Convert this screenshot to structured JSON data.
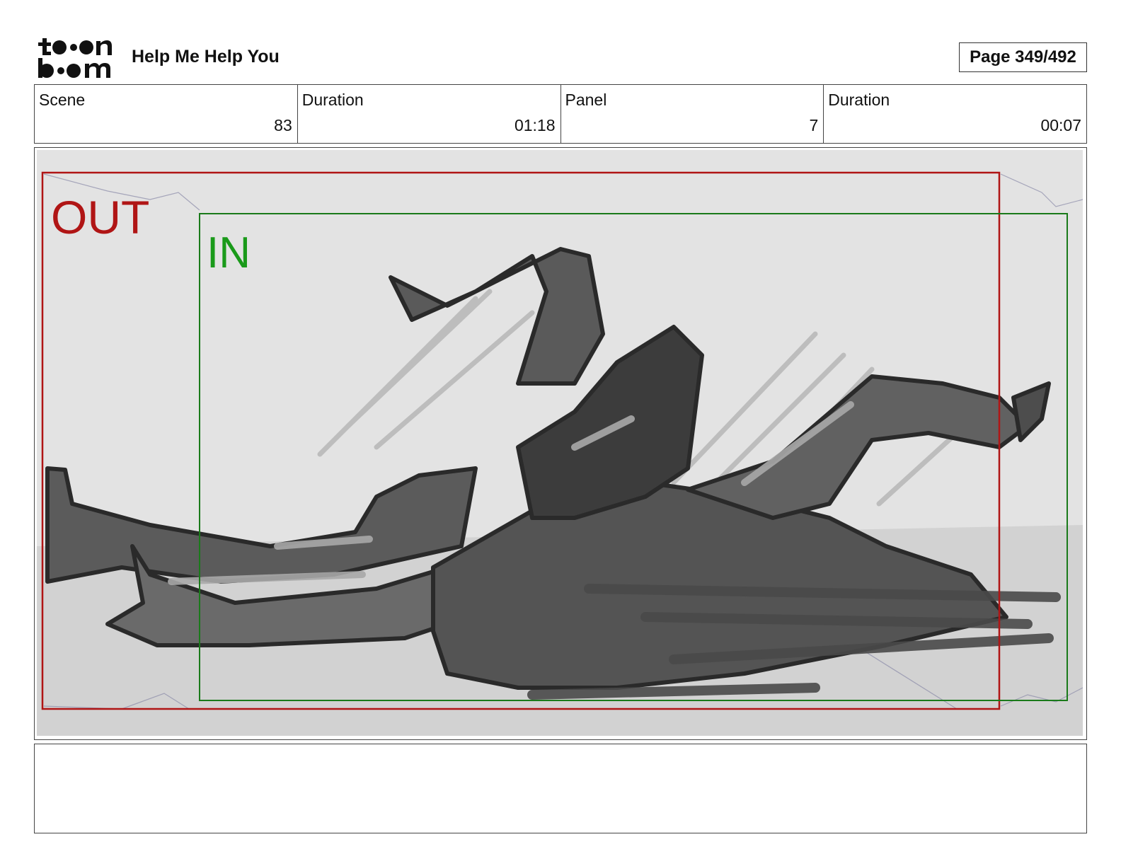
{
  "header": {
    "logo_text": "toon boom",
    "project_title": "Help Me Help You",
    "page_label": "Page 349/492"
  },
  "info": [
    {
      "label": "Scene",
      "value": "83"
    },
    {
      "label": "Duration",
      "value": "01:18"
    },
    {
      "label": "Panel",
      "value": "7"
    },
    {
      "label": "Duration",
      "value": "00:07"
    }
  ],
  "panel": {
    "out_label": "OUT",
    "in_label": "IN",
    "out_color": "#b01515",
    "in_color": "#1a7a1a"
  },
  "notes": {
    "text": ""
  }
}
